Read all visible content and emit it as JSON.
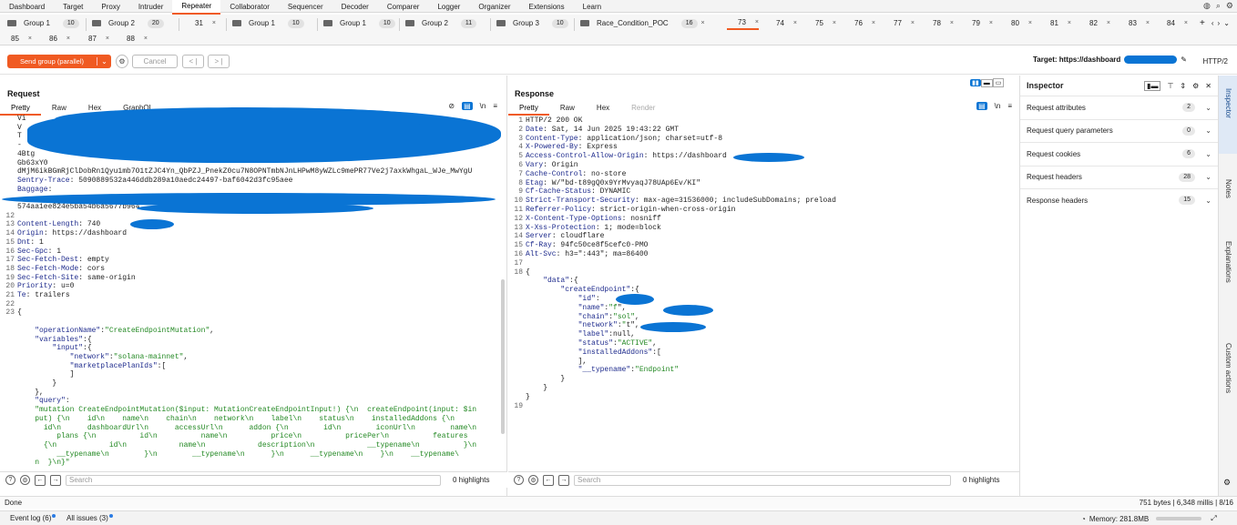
{
  "menu": [
    "Dashboard",
    "Target",
    "Proxy",
    "Intruder",
    "Repeater",
    "Collaborator",
    "Sequencer",
    "Decoder",
    "Comparer",
    "Logger",
    "Organizer",
    "Extensions",
    "Learn"
  ],
  "active_menu": "Repeater",
  "tabs_row1": [
    {
      "label": "Group 1",
      "count": "10",
      "group": true
    },
    {
      "label": "Group 2",
      "count": "20",
      "group": true
    },
    {
      "label": "31",
      "close": "×"
    },
    {
      "label": "Group 1",
      "count": "10",
      "group": true
    },
    {
      "label": "Group 1",
      "count": "10",
      "group": true
    },
    {
      "label": "Group 2",
      "count": "11",
      "group": true
    },
    {
      "label": "Group 3",
      "count": "10",
      "group": true
    },
    {
      "label": "Race_Condition_POC",
      "count": "16",
      "group": true,
      "close": "×"
    },
    {
      "label": "73",
      "close": "×",
      "active": true
    },
    {
      "label": "74",
      "close": "×"
    },
    {
      "label": "75",
      "close": "×"
    },
    {
      "label": "76",
      "close": "×"
    },
    {
      "label": "77",
      "close": "×"
    },
    {
      "label": "78",
      "close": "×"
    },
    {
      "label": "79",
      "close": "×"
    },
    {
      "label": "80",
      "close": "×"
    },
    {
      "label": "81",
      "close": "×"
    },
    {
      "label": "82",
      "close": "×"
    },
    {
      "label": "83",
      "close": "×"
    },
    {
      "label": "84",
      "close": "×"
    }
  ],
  "tabs_row2": [
    {
      "label": "85",
      "close": "×"
    },
    {
      "label": "86",
      "close": "×"
    },
    {
      "label": "87",
      "close": "×"
    },
    {
      "label": "88",
      "close": "×"
    }
  ],
  "toolbar": {
    "send_label": "Send group (parallel)",
    "cancel_label": "Cancel",
    "target_label": "Target: https://dashboard",
    "http_version": "HTTP/2"
  },
  "request": {
    "title": "Request",
    "subtabs": [
      "Pretty",
      "Raw",
      "Hex",
      "GraphQL"
    ],
    "lines": [
      {
        "n": "",
        "t": "Vi"
      },
      {
        "n": "",
        "t": "V"
      },
      {
        "n": "",
        "t": "T"
      },
      {
        "n": "",
        "t": "-"
      },
      {
        "n": "",
        "t": "4Btg"
      },
      {
        "n": "",
        "t": "Gb63xY0"
      },
      {
        "n": "",
        "t": "dMjM6ikBGmRjClDobRn1Qyu1mb7O1tZJC4Yn_QbPZJ_PnekZ0cu7N8OPNTmbNJnLHPwM8yWZLc9mePR77Ve2j7axkWhgaL_WJe_MwYgU"
      },
      {
        "n": "",
        "k": "Sentry-Trace",
        "v": ": 5090889532a446ddb289a10aedc24497-baf6042d3fc95aee"
      },
      {
        "n": "",
        "k": "Baggage",
        "v": ":"
      },
      {
        "n": "",
        "t": ""
      },
      {
        "n": "",
        "t": "574aa1ee824e5ba54b6a5677b964"
      },
      {
        "n": "12",
        "t": ""
      },
      {
        "n": "13",
        "k": "Content-Length",
        "v": ": 740"
      },
      {
        "n": "14",
        "k": "Origin",
        "v": ": https://dashboard"
      },
      {
        "n": "15",
        "k": "Dnt",
        "v": ": 1"
      },
      {
        "n": "16",
        "k": "Sec-Gpc",
        "v": ": 1"
      },
      {
        "n": "17",
        "k": "Sec-Fetch-Dest",
        "v": ": empty"
      },
      {
        "n": "18",
        "k": "Sec-Fetch-Mode",
        "v": ": cors"
      },
      {
        "n": "19",
        "k": "Sec-Fetch-Site",
        "v": ": same-origin"
      },
      {
        "n": "20",
        "k": "Priority",
        "v": ": u=0"
      },
      {
        "n": "21",
        "k": "Te",
        "v": ": trailers"
      },
      {
        "n": "22",
        "t": ""
      },
      {
        "n": "23",
        "t": "{"
      },
      {
        "n": "",
        "t": ""
      },
      {
        "n": "",
        "t": "    ",
        "k": "\"operationName\"",
        "v": ":",
        "s": "\"CreateEndpointMutation\"",
        "e": ","
      },
      {
        "n": "",
        "t": "    ",
        "k": "\"variables\"",
        "v": ":{"
      },
      {
        "n": "",
        "t": "        ",
        "k": "\"input\"",
        "v": ":{"
      },
      {
        "n": "",
        "t": "            ",
        "k": "\"network\"",
        "v": ":",
        "s": "\"solana-mainnet\"",
        "e": ","
      },
      {
        "n": "",
        "t": "            ",
        "k": "\"marketplacePlanIds\"",
        "v": ":["
      },
      {
        "n": "",
        "t": "            ]"
      },
      {
        "n": "",
        "t": "        }"
      },
      {
        "n": "",
        "t": "    },"
      },
      {
        "n": "",
        "t": "    ",
        "k": "\"query\"",
        "v": ":"
      },
      {
        "n": "",
        "t": "    ",
        "s": "\"mutation CreateEndpointMutation($input: MutationCreateEndpointInput!) {\\n  createEndpoint(input: $in"
      },
      {
        "n": "",
        "t": "    ",
        "s": "put) {\\n    id\\n    name\\n    chain\\n    network\\n    label\\n    status\\n    installedAddons {\\n"
      },
      {
        "n": "",
        "t": "      ",
        "s": "id\\n      dashboardUrl\\n      accessUrl\\n      addon {\\n        id\\n        iconUrl\\n        name\\n"
      },
      {
        "n": "",
        "t": "         ",
        "s": "plans {\\n          id\\n          name\\n          price\\n          pricePer\\n          features"
      },
      {
        "n": "",
        "t": "      ",
        "s": "{\\n            id\\n            name\\n            description\\n            __typename\\n          }\\n"
      },
      {
        "n": "",
        "t": "         ",
        "s": "__typename\\n        }\\n        __typename\\n      }\\n      __typename\\n    }\\n    __typename\\"
      },
      {
        "n": "",
        "t": "    ",
        "s": "n  }\\n}\""
      },
      {
        "n": "",
        "t": "}"
      }
    ],
    "search_placeholder": "Search",
    "highlights": "0 highlights"
  },
  "response": {
    "title": "Response",
    "subtabs": [
      "Pretty",
      "Raw",
      "Hex",
      "Render"
    ],
    "lines": [
      {
        "n": "1",
        "t": "HTTP/2 200 OK"
      },
      {
        "n": "2",
        "k": "Date",
        "v": ": Sat, 14 Jun 2025 19:43:22 GMT"
      },
      {
        "n": "3",
        "k": "Content-Type",
        "v": ": application/json; charset=utf-8"
      },
      {
        "n": "4",
        "k": "X-Powered-By",
        "v": ": Express"
      },
      {
        "n": "5",
        "k": "Access-Control-Allow-Origin",
        "v": ": https://dashboard"
      },
      {
        "n": "6",
        "k": "Vary",
        "v": ": Origin"
      },
      {
        "n": "7",
        "k": "Cache-Control",
        "v": ": no-store"
      },
      {
        "n": "8",
        "k": "Etag",
        "v": ": W/\"bd-t89gQ0x9YrMvyaqJ78UAp6Ev/KI\""
      },
      {
        "n": "9",
        "k": "Cf-Cache-Status",
        "v": ": DYNAMIC"
      },
      {
        "n": "10",
        "k": "Strict-Transport-Security",
        "v": ": max-age=31536000; includeSubDomains; preload"
      },
      {
        "n": "11",
        "k": "Referrer-Policy",
        "v": ": strict-origin-when-cross-origin"
      },
      {
        "n": "12",
        "k": "X-Content-Type-Options",
        "v": ": nosniff"
      },
      {
        "n": "13",
        "k": "X-Xss-Protection",
        "v": ": 1; mode=block"
      },
      {
        "n": "14",
        "k": "Server",
        "v": ": cloudflare"
      },
      {
        "n": "15",
        "k": "Cf-Ray",
        "v": ": 94fc50ce8f5cefc0-PMO"
      },
      {
        "n": "16",
        "k": "Alt-Svc",
        "v": ": h3=\":443\"; ma=86400"
      },
      {
        "n": "17",
        "t": ""
      },
      {
        "n": "18",
        "t": "{"
      },
      {
        "n": "",
        "t": "    ",
        "k": "\"data\"",
        "v": ":{"
      },
      {
        "n": "",
        "t": "        ",
        "k": "\"createEndpoint\"",
        "v": ":{"
      },
      {
        "n": "",
        "t": "            ",
        "k": "\"id\"",
        "v": ":"
      },
      {
        "n": "",
        "t": "            ",
        "k": "\"name\"",
        "v": ":",
        "s": "\"f",
        "e": "\","
      },
      {
        "n": "",
        "t": "            ",
        "k": "\"chain\"",
        "v": ":",
        "s": "\"sol\"",
        "e": ","
      },
      {
        "n": "",
        "t": "            ",
        "k": "\"network\"",
        "v": ":",
        "s": "\"",
        "e": "t\","
      },
      {
        "n": "",
        "t": "            ",
        "k": "\"label\"",
        "v": ":null,"
      },
      {
        "n": "",
        "t": "            ",
        "k": "\"status\"",
        "v": ":",
        "s": "\"ACTIVE\"",
        "e": ","
      },
      {
        "n": "",
        "t": "            ",
        "k": "\"installedAddons\"",
        "v": ":["
      },
      {
        "n": "",
        "t": "            ],"
      },
      {
        "n": "",
        "t": "            ",
        "k": "\"__typename\"",
        "v": ":",
        "s": "\"Endpoint\""
      },
      {
        "n": "",
        "t": "        }"
      },
      {
        "n": "",
        "t": "    }"
      },
      {
        "n": "",
        "t": "}"
      },
      {
        "n": "19",
        "t": ""
      }
    ],
    "search_placeholder": "Search",
    "highlights": "0 highlights"
  },
  "inspector": {
    "title": "Inspector",
    "rows": [
      {
        "label": "Request attributes",
        "count": "2"
      },
      {
        "label": "Request query parameters",
        "count": "0"
      },
      {
        "label": "Request cookies",
        "count": "6"
      },
      {
        "label": "Request headers",
        "count": "28"
      },
      {
        "label": "Response headers",
        "count": "15"
      }
    ]
  },
  "sidebar": [
    "Inspector",
    "Notes",
    "Explanations",
    "Custom actions"
  ],
  "status": {
    "left": "Done",
    "right": "751 bytes | 6,348 millis | 8/16"
  },
  "bottom": {
    "event_log": "Event log (6)",
    "all_issues": "All issues (3)",
    "memory": "Memory: 281.8MB"
  },
  "colors": {
    "accent": "#f05a22",
    "mask": "#0a74d4",
    "header_key": "#1d2a8c",
    "string": "#228822"
  }
}
